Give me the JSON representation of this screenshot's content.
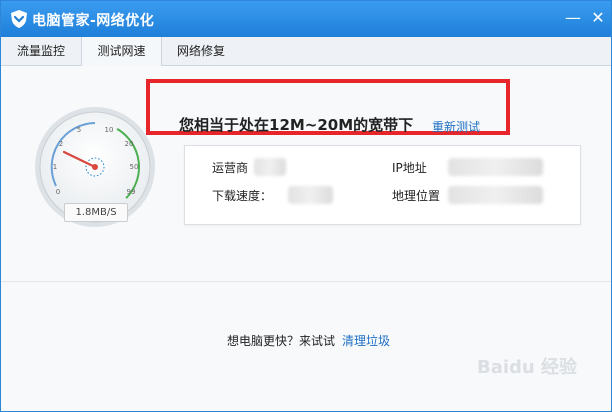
{
  "window": {
    "title": "电脑管家-网络优化",
    "minimize_symbol": "—",
    "close_symbol": "✕"
  },
  "tabs": [
    {
      "label": "流量监控",
      "active": false
    },
    {
      "label": "测试网速",
      "active": true
    },
    {
      "label": "网络修复",
      "active": false
    }
  ],
  "gauge": {
    "ticks": [
      "0",
      "1",
      "2",
      "5",
      "10",
      "20",
      "50",
      "99"
    ],
    "speed_label": "1.8MB/S",
    "needle_value_mbps": 1.8,
    "accent_color": "#4caf50",
    "needle_color": "#d9473f"
  },
  "result": {
    "headline": "您相当于处在12M~20M的宽带下",
    "retest_link": "重新测试",
    "highlight_color": "#e6262a"
  },
  "info": {
    "isp_label": "运营商",
    "ip_label": "IP地址",
    "download_label": "下载速度：",
    "location_label": "地理位置"
  },
  "footer": {
    "prompt": "想电脑更快？来试试",
    "link": "清理垃圾"
  },
  "colors": {
    "titlebar": "#2e8ae0",
    "link": "#1f6fc5"
  }
}
